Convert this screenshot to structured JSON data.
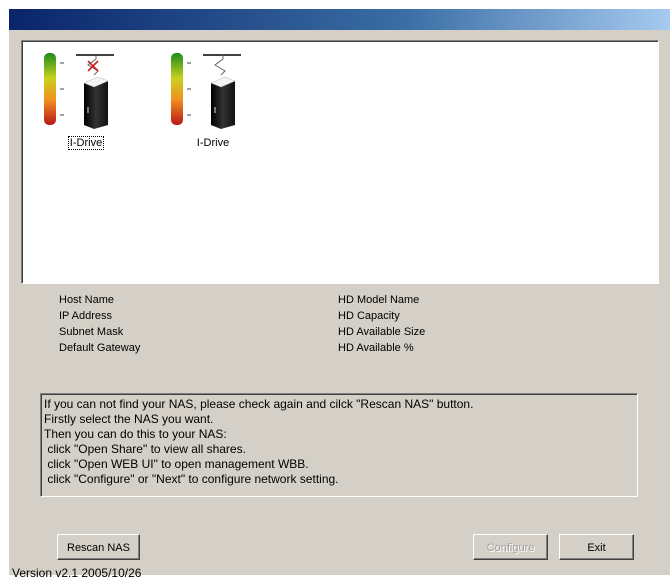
{
  "devices": [
    {
      "label": "I-Drive",
      "status": "disconnected",
      "selected": true
    },
    {
      "label": "I-Drive",
      "status": "connected",
      "selected": false
    }
  ],
  "info_left": [
    "Host Name",
    "IP Address",
    "Subnet Mask",
    "Default Gateway"
  ],
  "info_right": [
    "HD Model Name",
    "HD Capacity",
    "HD Available Size",
    "HD Available %"
  ],
  "hint_lines": [
    "If you can not find your NAS, please check again and cilck \"Rescan NAS\" button.",
    "Firstly select the NAS you want.",
    "Then you can do this to your NAS:",
    " click \"Open Share\" to view all shares.",
    " click \"Open WEB UI\" to open management WBB.",
    " click \"Configure\" or \"Next\" to configure network setting."
  ],
  "buttons": {
    "rescan": "Rescan NAS",
    "configure": "Configure",
    "exit": "Exit"
  },
  "version": "Version v2.1 2005/10/26",
  "colors": {
    "title_start": "#0a246a",
    "title_end": "#a6caf0",
    "face": "#d4d0c8",
    "disconnect_mark": "#cc2222"
  }
}
